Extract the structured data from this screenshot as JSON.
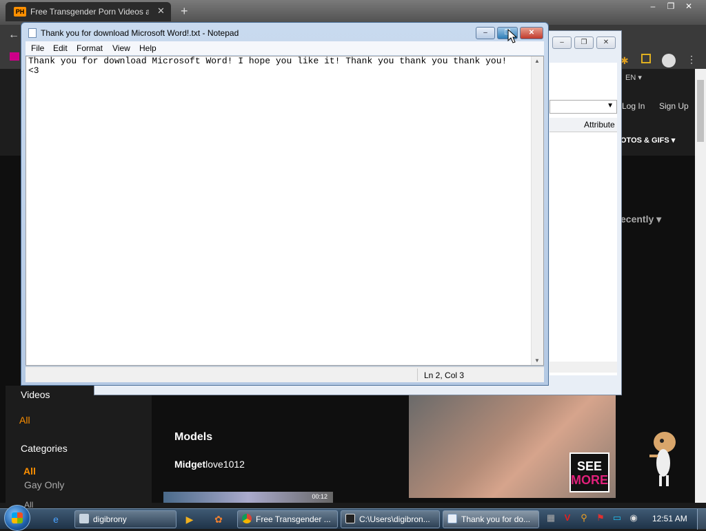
{
  "browser": {
    "tab_title": "Free Transgender Porn Videos a",
    "tab_favicon": "PH",
    "close_glyph": "✕",
    "new_tab_glyph": "+",
    "window_controls": [
      "–",
      "❐",
      "✕"
    ]
  },
  "website": {
    "lang": "EN ▾",
    "login": "Log In",
    "signup": "Sign Up",
    "nav_photos": "OTOS & GIFS ▾",
    "sort_recent": "ecently ▾",
    "sidebar": {
      "videos": "Videos",
      "all": "All",
      "categories": "Categories",
      "all_cat": "All",
      "gay_only": "Gay Only",
      "all_cut": "All"
    },
    "models_heading": "Models",
    "model_name_bold": "Midget",
    "model_name_rest": "love1012",
    "video_duration": "00:12",
    "ad_see": "SEE",
    "ad_more": "MORE",
    "accent_color": "#ff9000"
  },
  "explorer": {
    "column_attributes": "Attribute",
    "buttons": [
      "–",
      "❐",
      "✕"
    ]
  },
  "notepad": {
    "title": "Thank you for download Microsoft Word!.txt - Notepad",
    "menu": [
      "File",
      "Edit",
      "Format",
      "View",
      "Help"
    ],
    "content": "Thank you for download Microsoft Word! I hope you like it! Thank you thank you thank you!\n<3",
    "status_position": "Ln 2, Col 3",
    "buttons": {
      "minimize": "–",
      "maximize": "❐",
      "close": "✕"
    }
  },
  "taskbar": {
    "items": [
      {
        "label": "digibrony",
        "icon": "user-icon"
      },
      {
        "label": "Free Transgender ...",
        "icon": "chrome-icon"
      },
      {
        "label": "C:\\Users\\digibron...",
        "icon": "7zip-icon"
      },
      {
        "label": "Thank you for do...",
        "icon": "notepad-icon"
      }
    ],
    "clock": "12:51 AM"
  }
}
